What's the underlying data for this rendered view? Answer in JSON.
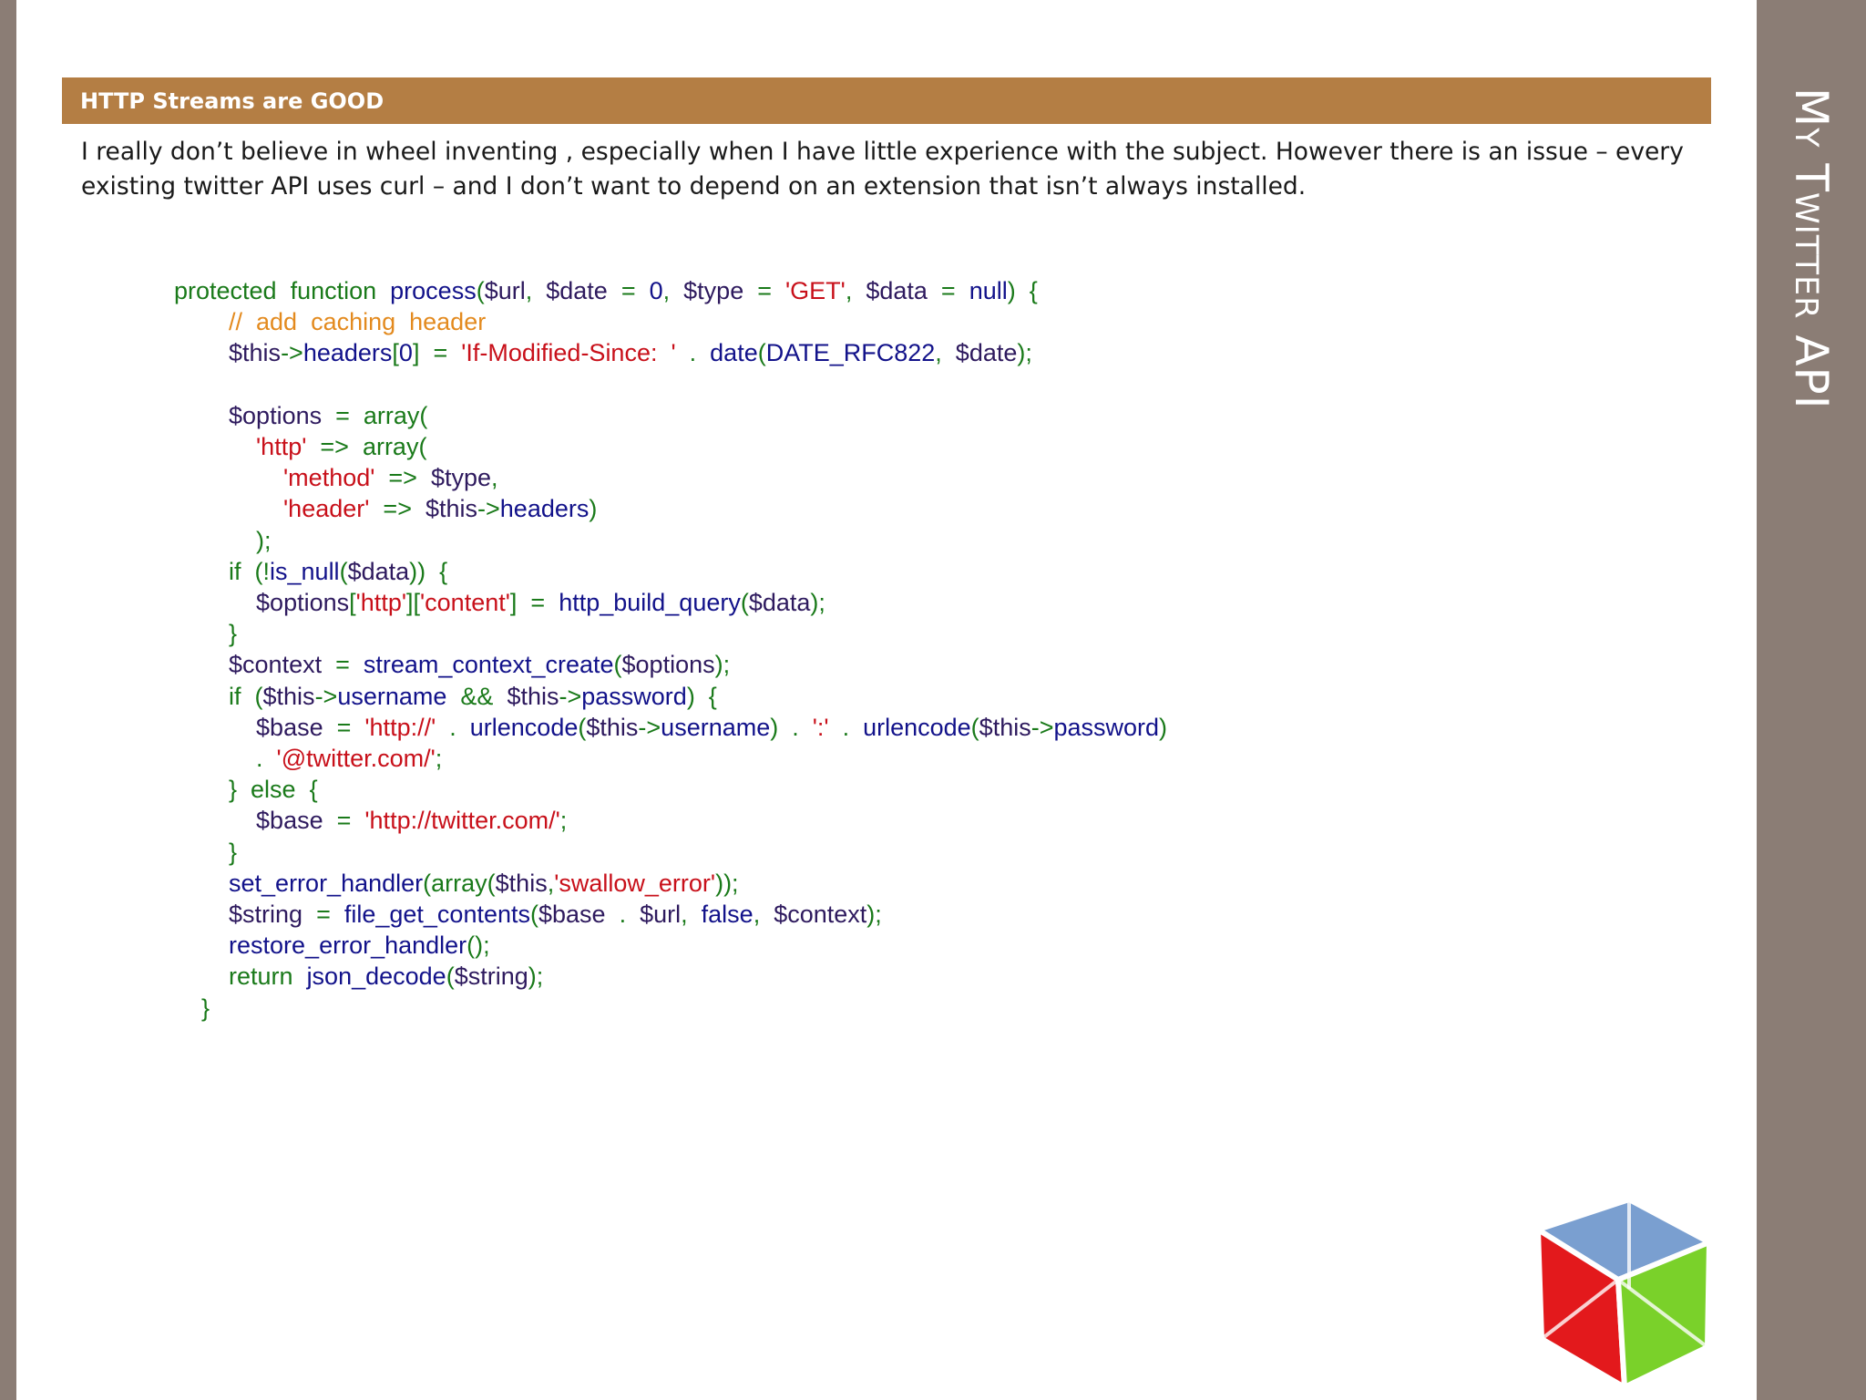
{
  "slide": {
    "title": "My Twitter API",
    "section_label": "HTTP Streams are GOOD",
    "intro_lines": [
      "I really don’t believe in wheel inventing , especially when I have little experience with the subject.  However there is an issue – every",
      "existing twitter API uses  curl – and I don’t want to depend on an extension that isn’t always installed."
    ]
  },
  "colors": {
    "side_bar": "#8b7d75",
    "header_bar": "#b47e44",
    "keyword": "#1a7a1a",
    "function": "#12128a",
    "variable": "#2e1a5e",
    "string": "#c8101a",
    "comment": "#e38a1e"
  },
  "logo": {
    "icon": "gtk-cube-logo"
  },
  "code": {
    "language": "php",
    "lines": [
      [
        [
          "kw",
          "protected  function  "
        ],
        [
          "fn",
          "process"
        ],
        [
          "op",
          "("
        ],
        [
          "var",
          "$url"
        ],
        [
          "op",
          ",  "
        ],
        [
          "var",
          "$date"
        ],
        [
          "op",
          "  =  "
        ],
        [
          "num",
          "0"
        ],
        [
          "op",
          ",  "
        ],
        [
          "var",
          "$type"
        ],
        [
          "op",
          "  =  "
        ],
        [
          "str",
          "'GET'"
        ],
        [
          "op",
          ",  "
        ],
        [
          "var",
          "$data"
        ],
        [
          "op",
          "  =  "
        ],
        [
          "fn",
          "null"
        ],
        [
          "op",
          ")  {"
        ]
      ],
      [
        [
          "cm",
          "        //  add  caching  header"
        ]
      ],
      [
        [
          "pl",
          "        "
        ],
        [
          "var",
          "$this"
        ],
        [
          "op",
          "->"
        ],
        [
          "fn",
          "headers"
        ],
        [
          "op",
          "["
        ],
        [
          "num",
          "0"
        ],
        [
          "op",
          "]  =  "
        ],
        [
          "str",
          "'If-Modified-Since:  '"
        ],
        [
          "op",
          "  .  "
        ],
        [
          "fn",
          "date"
        ],
        [
          "op",
          "("
        ],
        [
          "fn",
          "DATE_RFC822"
        ],
        [
          "op",
          ",  "
        ],
        [
          "var",
          "$date"
        ],
        [
          "op",
          ");"
        ]
      ],
      [
        [
          "pl",
          " "
        ]
      ],
      [
        [
          "pl",
          "        "
        ],
        [
          "var",
          "$options"
        ],
        [
          "op",
          "  =  "
        ],
        [
          "kw",
          "array("
        ]
      ],
      [
        [
          "pl",
          "            "
        ],
        [
          "str",
          "'http'"
        ],
        [
          "op",
          "  =>  "
        ],
        [
          "kw",
          "array("
        ]
      ],
      [
        [
          "pl",
          "                "
        ],
        [
          "str",
          "'method'"
        ],
        [
          "op",
          "  =>  "
        ],
        [
          "var",
          "$type"
        ],
        [
          "op",
          ","
        ]
      ],
      [
        [
          "pl",
          "                "
        ],
        [
          "str",
          "'header'"
        ],
        [
          "op",
          "  =>  "
        ],
        [
          "var",
          "$this"
        ],
        [
          "op",
          "->"
        ],
        [
          "fn",
          "headers"
        ],
        [
          "op",
          ")"
        ]
      ],
      [
        [
          "pl",
          "            "
        ],
        [
          "op",
          ");"
        ]
      ],
      [
        [
          "pl",
          "        "
        ],
        [
          "kw",
          "if  (!"
        ],
        [
          "fn",
          "is_null"
        ],
        [
          "op",
          "("
        ],
        [
          "var",
          "$data"
        ],
        [
          "op",
          "))  {"
        ]
      ],
      [
        [
          "pl",
          "            "
        ],
        [
          "var",
          "$options"
        ],
        [
          "op",
          "["
        ],
        [
          "str",
          "'http'"
        ],
        [
          "op",
          "]["
        ],
        [
          "str",
          "'content'"
        ],
        [
          "op",
          "]  =  "
        ],
        [
          "fn",
          "http_build_query"
        ],
        [
          "op",
          "("
        ],
        [
          "var",
          "$data"
        ],
        [
          "op",
          ");"
        ]
      ],
      [
        [
          "pl",
          "        "
        ],
        [
          "op",
          "}"
        ]
      ],
      [
        [
          "pl",
          "        "
        ],
        [
          "var",
          "$context"
        ],
        [
          "op",
          "  =  "
        ],
        [
          "fn",
          "stream_context_create"
        ],
        [
          "op",
          "("
        ],
        [
          "var",
          "$options"
        ],
        [
          "op",
          ");"
        ]
      ],
      [
        [
          "pl",
          "        "
        ],
        [
          "kw",
          "if  ("
        ],
        [
          "var",
          "$this"
        ],
        [
          "op",
          "->"
        ],
        [
          "fn",
          "username"
        ],
        [
          "op",
          "  &&  "
        ],
        [
          "var",
          "$this"
        ],
        [
          "op",
          "->"
        ],
        [
          "fn",
          "password"
        ],
        [
          "op",
          ")  {"
        ]
      ],
      [
        [
          "pl",
          "            "
        ],
        [
          "var",
          "$base"
        ],
        [
          "op",
          "  =  "
        ],
        [
          "str",
          "'http://'"
        ],
        [
          "op",
          "  .  "
        ],
        [
          "fn",
          "urlencode"
        ],
        [
          "op",
          "("
        ],
        [
          "var",
          "$this"
        ],
        [
          "op",
          "->"
        ],
        [
          "fn",
          "username"
        ],
        [
          "op",
          ")  .  "
        ],
        [
          "str",
          "':'"
        ],
        [
          "op",
          "  .  "
        ],
        [
          "fn",
          "urlencode"
        ],
        [
          "op",
          "("
        ],
        [
          "var",
          "$this"
        ],
        [
          "op",
          "->"
        ],
        [
          "fn",
          "password"
        ],
        [
          "op",
          ")"
        ]
      ],
      [
        [
          "pl",
          "            "
        ],
        [
          "op",
          ".  "
        ],
        [
          "str",
          "'@twitter.com/'"
        ],
        [
          "op",
          ";"
        ]
      ],
      [
        [
          "pl",
          "        "
        ],
        [
          "op",
          "}  else  {"
        ]
      ],
      [
        [
          "pl",
          "            "
        ],
        [
          "var",
          "$base"
        ],
        [
          "op",
          "  =  "
        ],
        [
          "str",
          "'http://twitter.com/'"
        ],
        [
          "op",
          ";"
        ]
      ],
      [
        [
          "pl",
          "        "
        ],
        [
          "op",
          "}"
        ]
      ],
      [
        [
          "pl",
          "        "
        ],
        [
          "fn",
          "set_error_handler"
        ],
        [
          "op",
          "(array("
        ],
        [
          "var",
          "$this"
        ],
        [
          "op",
          ","
        ],
        [
          "str",
          "'swallow_error'"
        ],
        [
          "op",
          "));"
        ]
      ],
      [
        [
          "pl",
          "        "
        ],
        [
          "var",
          "$string"
        ],
        [
          "op",
          "  =  "
        ],
        [
          "fn",
          "file_get_contents"
        ],
        [
          "op",
          "("
        ],
        [
          "var",
          "$base"
        ],
        [
          "op",
          "  .  "
        ],
        [
          "var",
          "$url"
        ],
        [
          "op",
          ",  "
        ],
        [
          "fn",
          "false"
        ],
        [
          "op",
          ",  "
        ],
        [
          "var",
          "$context"
        ],
        [
          "op",
          ");"
        ]
      ],
      [
        [
          "pl",
          "        "
        ],
        [
          "fn",
          "restore_error_handler"
        ],
        [
          "op",
          "();"
        ]
      ],
      [
        [
          "pl",
          "        "
        ],
        [
          "kw",
          "return  "
        ],
        [
          "fn",
          "json_decode"
        ],
        [
          "op",
          "("
        ],
        [
          "var",
          "$string"
        ],
        [
          "op",
          ");"
        ]
      ],
      [
        [
          "pl",
          "    "
        ],
        [
          "op",
          "}"
        ]
      ]
    ]
  }
}
